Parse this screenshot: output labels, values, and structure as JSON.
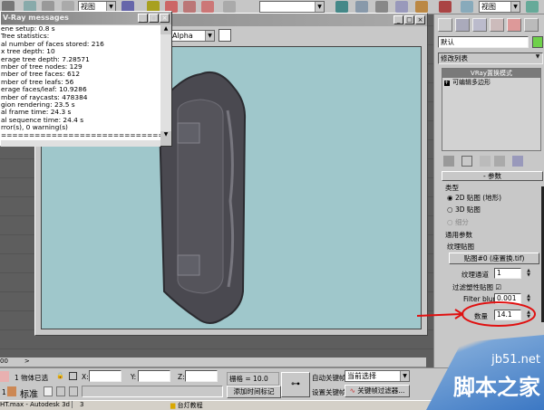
{
  "toolbar": {
    "view_combo": "视图",
    "view_combo_right": "视图"
  },
  "render_window": {
    "channel_combo": "Alpha"
  },
  "messages": {
    "title": "V-Ray messages",
    "lines": [
      "ene setup: 0.8 s",
      "Tree statistics:",
      "al number of faces stored: 216",
      "x tree depth: 10",
      "erage tree depth: 7.28571",
      "mber of tree nodes: 129",
      "mber of tree faces: 612",
      "mber of tree leafs: 56",
      "erage faces/leaf: 10.9286",
      "mber of raycasts: 478384",
      "gion rendering: 23.5 s",
      "al frame time: 24.3 s",
      "al sequence time: 24.4 s",
      "rror(s), 0 warning(s)",
      "================================"
    ]
  },
  "command_panel": {
    "object_name": "默认",
    "object_color": "#6fd14a",
    "modifier_list": "修改列表",
    "stack": [
      "VRay置换模式",
      "可编辑多边形"
    ],
    "rollout_title": "参数",
    "type_group": "类型",
    "type_options": [
      "2D 贴图 (地形)",
      "3D 贴图",
      "细分"
    ],
    "common_group": "通用参数",
    "texmap_label": "纹理贴图",
    "texmap_button": "贴图#0 (座置换.tif)",
    "tex_channel_label": "纹理通道",
    "tex_channel_value": "1",
    "filter_label": "过滤塑性贴图",
    "filter_blur_label": "Filter blur",
    "filter_blur_value": "0.001",
    "amount_label": "数量",
    "amount_value": "14.1",
    "annotation_color": "#e01010"
  },
  "timeline": {
    "frame": "00",
    "arrow": ">"
  },
  "status": {
    "selected": "1 物体已选",
    "x_label": "X:",
    "y_label": "Y:",
    "z_label": "Z:",
    "grid": "栅格 = 10.0",
    "add_time_tag": "添加时间标记",
    "auto_key": "自动关键帧",
    "set_key": "设置关键帧",
    "selection_combo": "当前选择",
    "key_filters": "关键帧过滤器...",
    "standard": "标准",
    "num": "1"
  },
  "taskbar": {
    "item1": "HT.max - Autodesk 3d",
    "item2": "台灯教程",
    "item_mid": "3"
  },
  "watermark": {
    "url": "jb51.net",
    "name": "脚本之家"
  }
}
